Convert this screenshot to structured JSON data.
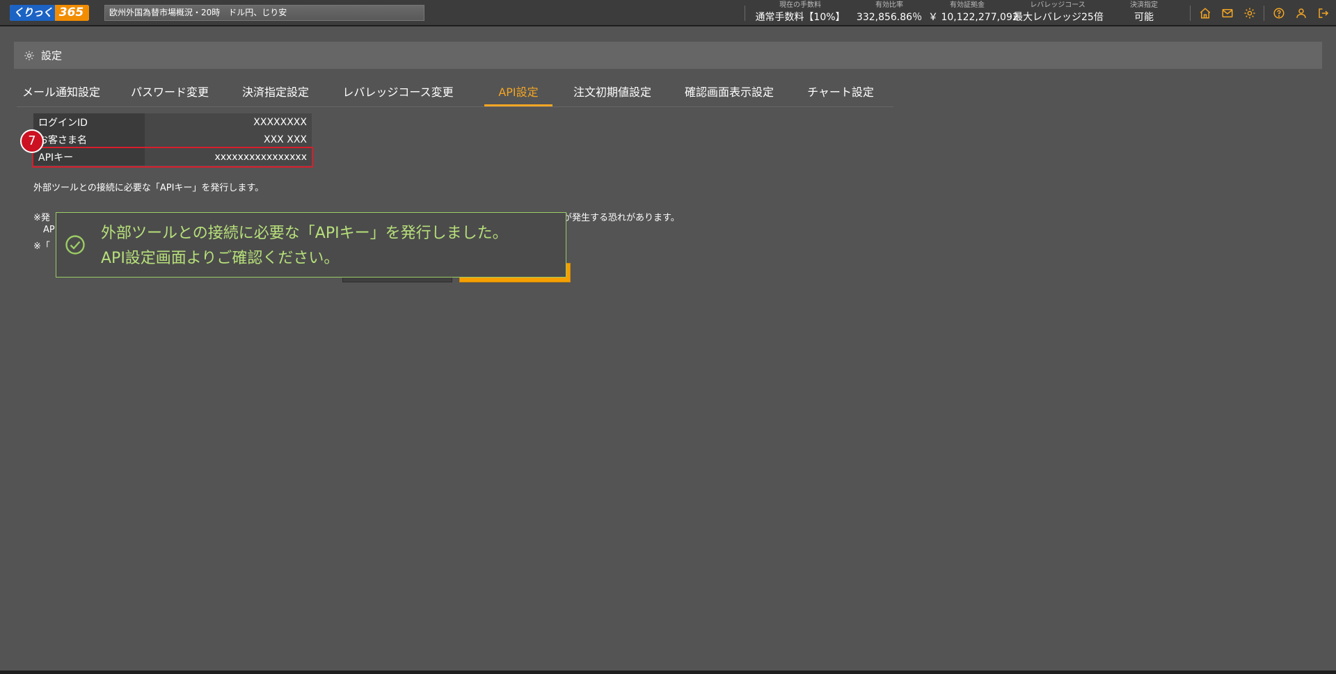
{
  "app": {
    "logo_text_a": "くりっく",
    "logo_text_b": "365",
    "ticker": "欧州外国為替市場概況・20時　ドル円、じり安"
  },
  "header_stats": [
    {
      "label": "現在の手数料",
      "value": "通常手数料【10%】"
    },
    {
      "label": "有効比率",
      "value": "332,856.86％"
    },
    {
      "label": "有効証拠金",
      "value": "￥ 10,122,277,092"
    },
    {
      "label": "レバレッジコース",
      "value": "最大レバレッジ25倍"
    },
    {
      "label": "決済指定",
      "value": "可能"
    }
  ],
  "header_icons": [
    "home-icon",
    "mail-icon",
    "gear-icon",
    "help-icon",
    "user-icon",
    "logout-icon"
  ],
  "settings": {
    "title": "設定",
    "tabs": [
      {
        "label": "メール通知設定",
        "active": false
      },
      {
        "label": "パスワード変更",
        "active": false
      },
      {
        "label": "決済指定設定",
        "active": false
      },
      {
        "label": "レバレッジコース変更",
        "active": false
      },
      {
        "label": "API設定",
        "active": true
      },
      {
        "label": "注文初期値設定",
        "active": false
      },
      {
        "label": "確認画面表示設定",
        "active": false
      },
      {
        "label": "チャート設定",
        "active": false
      }
    ]
  },
  "account": {
    "rows": [
      {
        "key": "ログインID",
        "value": "XXXXXXXX"
      },
      {
        "key": "お客さま名",
        "value": "XXX XXX"
      },
      {
        "key": "APIキー",
        "value": "xxxxxxxxxxxxxxxx"
      }
    ],
    "step_badge": "7"
  },
  "content": {
    "description": "外部ツールとの接続に必要な「APIキー」を発行します。",
    "note1_start": "※発",
    "note1_end": "害が発生する恐れがあります。",
    "note1b": "AP",
    "note2": "※「"
  },
  "toast": {
    "line1": "外部ツールとの接続に必要な「APIキー」を発行しました。",
    "line2": "API設定画面よりご確認ください。"
  },
  "colors": {
    "accent": "#f5a623",
    "success": "#b7e07a",
    "highlight": "#d81e2c",
    "background": "#545454"
  }
}
